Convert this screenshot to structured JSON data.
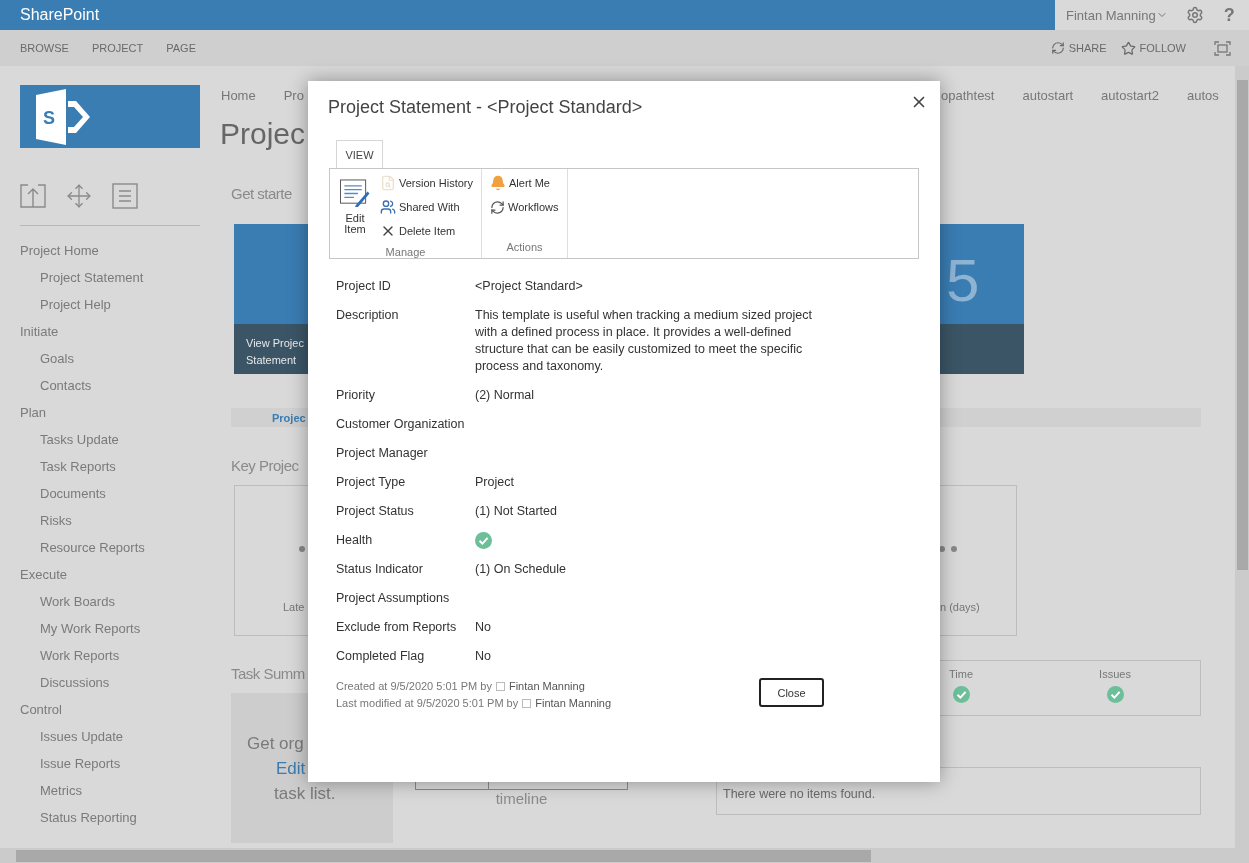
{
  "suite_bar": {
    "brand": "SharePoint",
    "user": "Fintan Manning",
    "help": "?"
  },
  "ribbon": {
    "tabs": [
      "BROWSE",
      "PROJECT",
      "PAGE"
    ],
    "actions": [
      "SHARE",
      "FOLLOW"
    ]
  },
  "logo": {
    "letter": "S"
  },
  "nav": [
    {
      "label": "Project Home",
      "children": [
        {
          "label": "Project Statement"
        },
        {
          "label": "Project Help"
        }
      ]
    },
    {
      "label": "Initiate",
      "children": [
        {
          "label": "Goals"
        },
        {
          "label": "Contacts"
        }
      ]
    },
    {
      "label": "Plan",
      "children": [
        {
          "label": "Tasks Update"
        },
        {
          "label": "Task Reports"
        },
        {
          "label": "Documents"
        },
        {
          "label": "Risks"
        },
        {
          "label": "Resource Reports"
        }
      ]
    },
    {
      "label": "Execute",
      "children": [
        {
          "label": "Work Boards"
        },
        {
          "label": "My Work Reports"
        },
        {
          "label": "Work Reports"
        },
        {
          "label": "Discussions"
        }
      ]
    },
    {
      "label": "Control",
      "children": [
        {
          "label": "Issues Update"
        },
        {
          "label": "Issue Reports"
        },
        {
          "label": "Metrics"
        },
        {
          "label": "Status Reporting"
        }
      ]
    }
  ],
  "page": {
    "breadcrumbs_left": [
      "Home",
      "Pro"
    ],
    "breadcrumbs_right": [
      "opathtest",
      "autostart",
      "autostart2",
      "autos"
    ],
    "title": "Projec",
    "get_started": "Get starte",
    "tile_caption": [
      "View Projec",
      "Statement"
    ],
    "tile_right_glyph": "5",
    "tab_strip_label": "Projec",
    "key_heading": "Key Projec",
    "key_left_label": "Late",
    "key_right_label": "n (days)",
    "task_heading": "Task Summ",
    "task_promo": {
      "line_1": "Get org",
      "link": "Edit",
      "line_3": "task list."
    },
    "timeline_label": "timeline",
    "indicators": [
      {
        "label": "Time",
        "on_track": true
      },
      {
        "label": "Issues",
        "on_track": true
      }
    ],
    "no_items": "There were no items found."
  },
  "dialog": {
    "title": "Project Statement - <Project Standard>",
    "tab": "VIEW",
    "groups": [
      {
        "name": "Manage",
        "large": {
          "label": [
            "Edit",
            "Item"
          ]
        },
        "items": [
          {
            "label": "Version History",
            "disabled": true
          },
          {
            "label": "Shared With",
            "disabled": false
          },
          {
            "label": "Delete Item",
            "disabled": false
          }
        ]
      },
      {
        "name": "Actions",
        "items": [
          {
            "label": "Alert Me",
            "disabled": false
          },
          {
            "label": "Workflows",
            "disabled": false
          }
        ]
      }
    ],
    "fields": [
      {
        "label": "Project ID",
        "kind": "text",
        "value": "<Project Standard>"
      },
      {
        "label": "Description",
        "kind": "text",
        "value": "This template is useful when tracking a medium sized project with a defined process in place. It provides a well-defined structure that can be easily customized to meet the specific process and taxonomy."
      },
      {
        "label": "Priority",
        "kind": "text",
        "value": "(2) Normal"
      },
      {
        "label": "Customer Organization",
        "kind": "text"
      },
      {
        "label": "Project Manager",
        "kind": "text"
      },
      {
        "label": "Project Type",
        "kind": "text",
        "value": "Project"
      },
      {
        "label": "Project Status",
        "kind": "text",
        "value": "(1) Not Started"
      },
      {
        "label": "Health",
        "kind": "indicator",
        "on_track": true
      },
      {
        "label": "Status Indicator",
        "kind": "text",
        "value": "(1) On Schedule"
      },
      {
        "label": "Project Assumptions",
        "kind": "text"
      },
      {
        "label": "Exclude from Reports",
        "kind": "text",
        "value": "No"
      },
      {
        "label": "Completed Flag",
        "kind": "text",
        "value": "No"
      }
    ],
    "footer": [
      {
        "text": "Created at 9/5/2020 5:01 PM  by",
        "user": "Fintan Manning"
      },
      {
        "text": "Last modified at 9/5/2020 5:01 PM  by",
        "user": "Fintan Manning"
      }
    ],
    "close_button": "Close"
  }
}
